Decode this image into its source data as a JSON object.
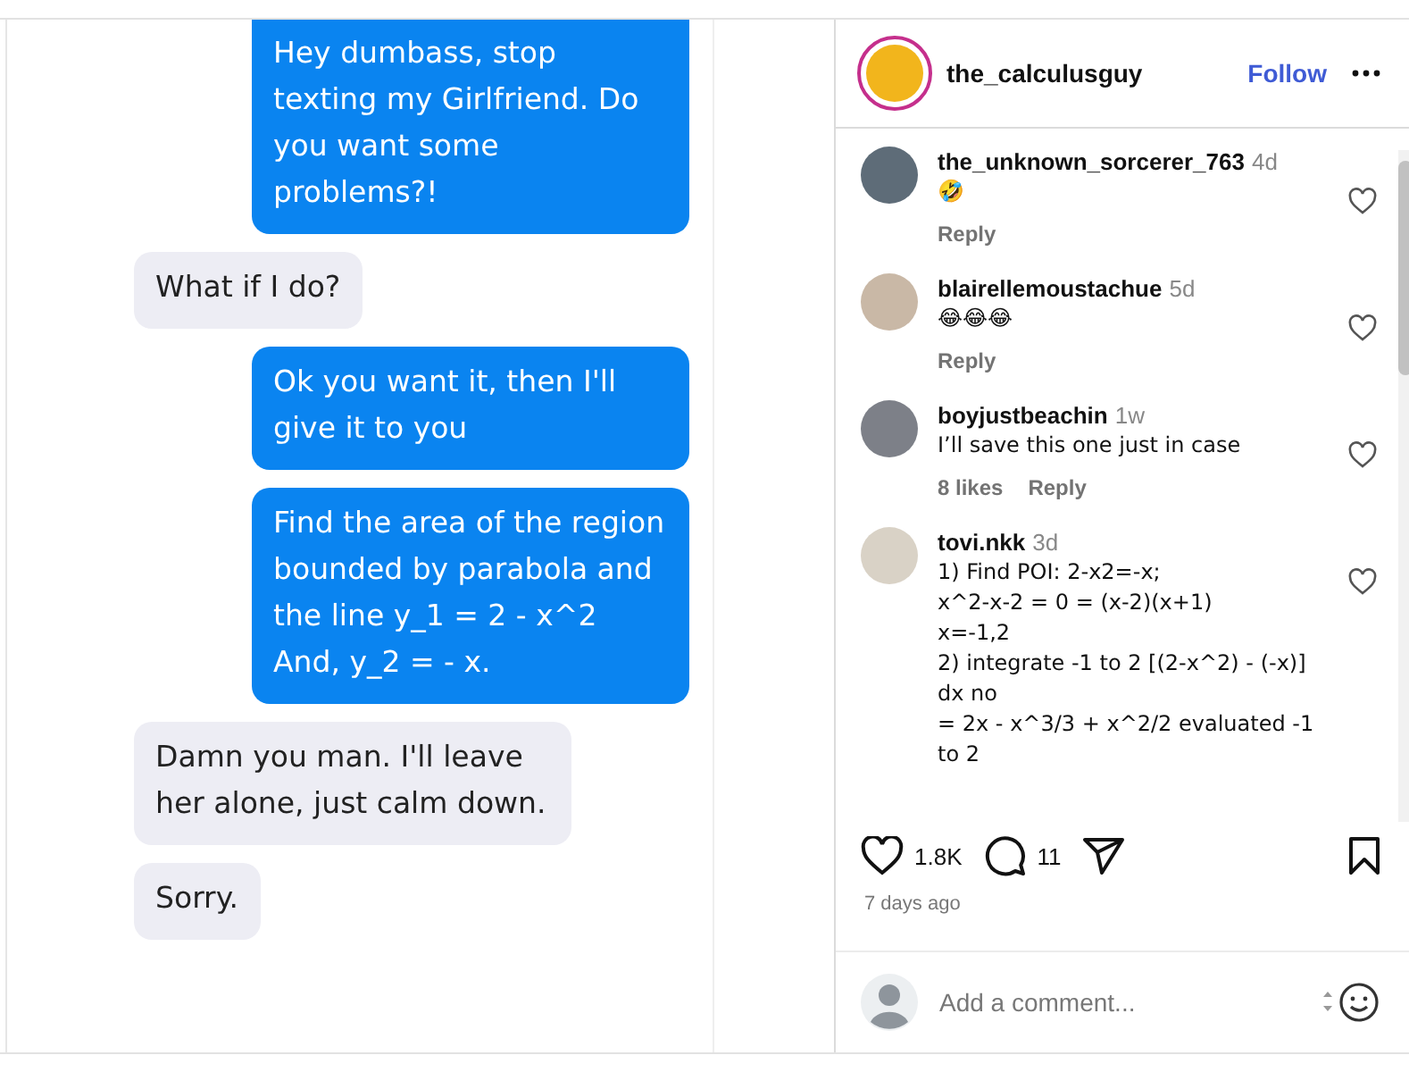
{
  "post_image": {
    "messages": [
      {
        "kind": "sent",
        "text": "Hey dumbass, stop texting my Girlfriend. Do you want some problems?!"
      },
      {
        "kind": "received",
        "text": "What if I do?"
      },
      {
        "kind": "sent",
        "text": "Ok you want it, then I'll give it to you"
      },
      {
        "kind": "sent",
        "text": "Find the area of the region bounded by parabola and the line y_1 = 2 - x^2 And, y_2 = - x."
      },
      {
        "kind": "received",
        "text": "Damn you man. I'll leave her alone, just calm down."
      },
      {
        "kind": "received",
        "text": "Sorry."
      }
    ]
  },
  "header": {
    "username": "the_calculusguy",
    "follow": "Follow"
  },
  "comments": [
    {
      "username": "the_unknown_sorcerer_763",
      "time": "4d",
      "text": "🤣",
      "reply": "Reply"
    },
    {
      "username": "blairellemoustachue",
      "time": "5d",
      "text": "😂😂😂",
      "reply": "Reply"
    },
    {
      "username": "boyjustbeachin",
      "time": "1w",
      "text": "I’ll save this one just in case",
      "likes": "8 likes",
      "reply": "Reply"
    },
    {
      "username": "tovi.nkk",
      "time": "3d",
      "text": "1) Find POI: 2-x2=-x;\nx^2-x-2 = 0 = (x-2)(x+1)\nx=-1,2\n2) integrate -1 to 2 [(2-x^2) - (-x)]\ndx no\n= 2x - x^3/3 + x^2/2 evaluated -1\nto 2"
    }
  ],
  "actions": {
    "likes": "1.8K",
    "comments": "11"
  },
  "posted": "7 days ago",
  "comment_input": {
    "placeholder": "Add a comment..."
  }
}
